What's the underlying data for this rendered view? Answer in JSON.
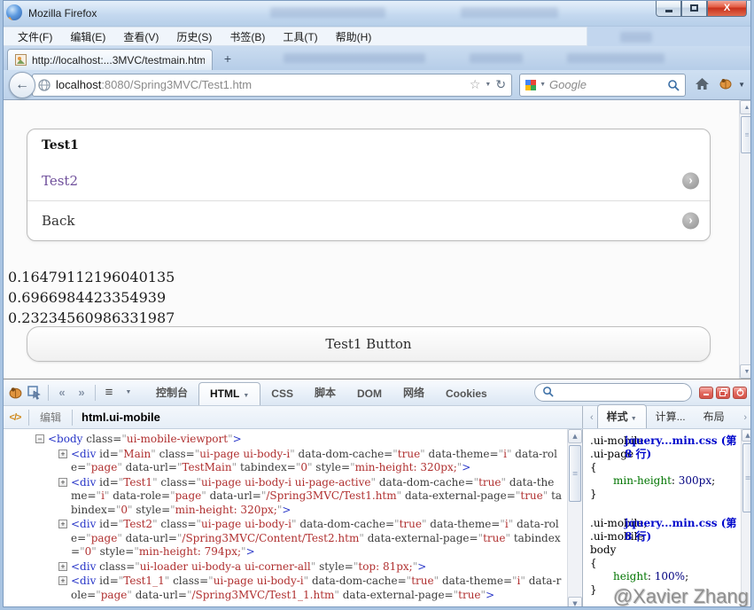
{
  "window": {
    "title": "Mozilla Firefox"
  },
  "menu": {
    "items": [
      "文件(F)",
      "编辑(E)",
      "查看(V)",
      "历史(S)",
      "书签(B)",
      "工具(T)",
      "帮助(H)"
    ]
  },
  "tabstrip": {
    "active_tab_title": "http://localhost:...3MVC/testmain.htm",
    "new_tab_label": "+"
  },
  "navbar": {
    "url_host": "localhost",
    "url_rest": ":8080/Spring3MVC/Test1.htm",
    "search_placeholder": "Google"
  },
  "page": {
    "list": {
      "header": "Test1",
      "items": [
        {
          "label": "Test2",
          "visited": true
        },
        {
          "label": "Back",
          "visited": false
        }
      ]
    },
    "numbers": [
      "0.16479112196040135",
      "0.6966984423354939",
      "0.23234560986331987"
    ],
    "button_label": "Test1 Button"
  },
  "firebug": {
    "tabs": [
      "控制台",
      "HTML",
      "CSS",
      "脚本",
      "DOM",
      "网络",
      "Cookies"
    ],
    "active_tab": "HTML",
    "edit_label": "编辑",
    "breadcrumb": "html.ui-mobile",
    "style_tabs": [
      "样式",
      "计算...",
      "布局"
    ],
    "active_style_tab": "样式",
    "tree": [
      {
        "level": 0,
        "expanded": true,
        "tag": "body",
        "attrs": [
          {
            "name": "class",
            "value": "ui-mobile-viewport"
          }
        ]
      },
      {
        "level": 1,
        "expanded": false,
        "tag": "div",
        "attrs": [
          {
            "name": "id",
            "value": "Main"
          },
          {
            "name": "class",
            "value": "ui-page ui-body-i"
          },
          {
            "name": "data-dom-cache",
            "value": "true"
          },
          {
            "name": "data-theme",
            "value": "i"
          },
          {
            "name": "data-role",
            "value": "page"
          },
          {
            "name": "data-url",
            "value": "TestMain"
          },
          {
            "name": "tabindex",
            "value": "0"
          },
          {
            "name": "style",
            "value": "min-height: 320px;"
          }
        ]
      },
      {
        "level": 1,
        "expanded": false,
        "tag": "div",
        "attrs": [
          {
            "name": "id",
            "value": "Test1"
          },
          {
            "name": "class",
            "value": "ui-page ui-body-i ui-page-active"
          },
          {
            "name": "data-dom-cache",
            "value": "true"
          },
          {
            "name": "data-theme",
            "value": "i"
          },
          {
            "name": "data-role",
            "value": "page"
          },
          {
            "name": "data-url",
            "value": "/Spring3MVC/Test1.htm"
          },
          {
            "name": "data-external-page",
            "value": "true"
          },
          {
            "name": "tabindex",
            "value": "0"
          },
          {
            "name": "style",
            "value": "min-height: 320px;"
          }
        ]
      },
      {
        "level": 1,
        "expanded": false,
        "tag": "div",
        "attrs": [
          {
            "name": "id",
            "value": "Test2"
          },
          {
            "name": "class",
            "value": "ui-page ui-body-i"
          },
          {
            "name": "data-dom-cache",
            "value": "true"
          },
          {
            "name": "data-theme",
            "value": "i"
          },
          {
            "name": "data-role",
            "value": "page"
          },
          {
            "name": "data-url",
            "value": "/Spring3MVC/Content/Test2.htm"
          },
          {
            "name": "data-external-page",
            "value": "true"
          },
          {
            "name": "tabindex",
            "value": "0"
          },
          {
            "name": "style",
            "value": "min-height: 794px;"
          }
        ]
      },
      {
        "level": 1,
        "expanded": false,
        "tag": "div",
        "attrs": [
          {
            "name": "class",
            "value": "ui-loader ui-body-a ui-corner-all"
          },
          {
            "name": "style",
            "value": "top: 81px;"
          }
        ]
      },
      {
        "level": 1,
        "expanded": false,
        "tag": "div",
        "attrs": [
          {
            "name": "id",
            "value": "Test1_1"
          },
          {
            "name": "class",
            "value": "ui-page ui-body-i"
          },
          {
            "name": "data-dom-cache",
            "value": "true"
          },
          {
            "name": "data-theme",
            "value": "i"
          },
          {
            "name": "data-role",
            "value": "page"
          },
          {
            "name": "data-url",
            "value": "/Spring3MVC/Test1_1.htm"
          },
          {
            "name": "data-external-page",
            "value": "true"
          }
        ]
      }
    ],
    "css_rules": [
      {
        "file_link": "jquery...min.css (第 8 行)",
        "selector_lines": [
          ".ui-mobile",
          ".ui-page"
        ],
        "declarations": [
          {
            "prop": "min-height",
            "value": "300px"
          }
        ]
      },
      {
        "file_link": "jquery...min.css (第 8 行)",
        "selector_lines": [
          ".ui-mobile,",
          ".ui-mobile",
          "body"
        ],
        "declarations": [
          {
            "prop": "height",
            "value": "100%"
          }
        ]
      }
    ]
  },
  "icons": {
    "back_arrow": "←",
    "star": "☆",
    "caret_down": "▼",
    "reload": "↻",
    "prev_arrow": "‹",
    "next_arrow": "›",
    "double_prev": "«",
    "double_next": "»",
    "list": "≡",
    "code_brackets": "</>",
    "scroll_up": "▲",
    "scroll_down": "▼",
    "chevron_right": "›",
    "thumb_grip": "≡"
  },
  "watermark": "@Xavier Zhang",
  "colors": {
    "visited_link": "#6f4f9b",
    "tree_tag": "#2836c8",
    "tree_value": "#b03030",
    "css_link": "#0008cc",
    "css_property": "#007400",
    "css_value": "#000080"
  }
}
